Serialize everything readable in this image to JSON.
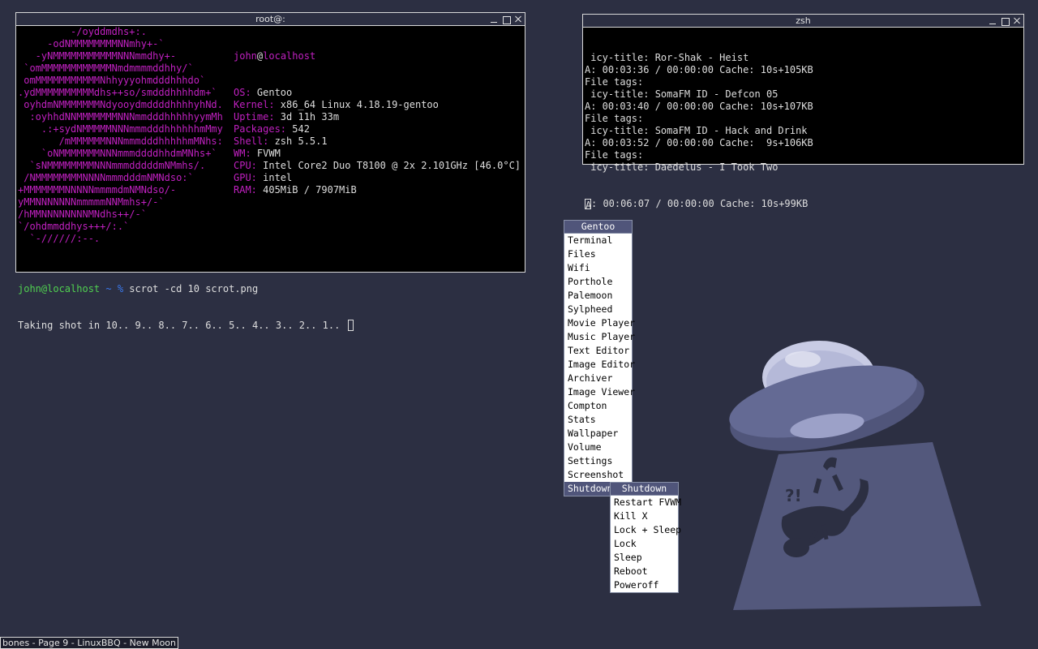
{
  "terminal1": {
    "title": "root@:",
    "logo": [
      "         -/oyddmdhs+:.",
      "     -odNMMMMMMMMNNmhy+-`",
      "   -yNMMMMMMMMMMMNNNmmdhy+-",
      " `omMMMMMMMMMMMMNmdmmmmddhhy/`",
      " omMMMMMMMMMMMNhhyyyohmdddhhhdo`",
      ".ydMMMMMMMMMMdhs++so/smdddhhhhdm+`",
      " oyhdmNMMMMMMMNdyooydmddddhhhhyhNd.",
      "  :oyhhdNNMMMMMMMNNNmmdddhhhhhyymMh",
      "    .:+sydNMMMMMNNNmmmdddhhhhhhmMmy",
      "       /mMMMMMMNNNmmmdddhhhhhmMNhs:",
      "    `oNMMMMMMMNNNmmmddddhhdmMNhs+`",
      "  `sNMMMMMMMMNNNmmmdddddmNMmhs/.",
      " /NMMMMMMMMNNNNmmmdddmNMNdso:`",
      "+MMMMMMMNNNNNmmmmdmNMNdso/-",
      "yMMNNNNNNNmmmmmNNMmhs+/-`",
      "/hMMNNNNNNNNMNdhs++/-`",
      "`/ohdmmddhys+++/:.`",
      "  `-//////:--."
    ],
    "info": {
      "user": "john",
      "at": "@",
      "host": "localhost",
      "rows": [
        {
          "key": "OS:",
          "value": " Gentoo"
        },
        {
          "key": "Kernel:",
          "value": " x86_64 Linux 4.18.19-gentoo"
        },
        {
          "key": "Uptime:",
          "value": " 3d 11h 33m"
        },
        {
          "key": "Packages:",
          "value": " 542"
        },
        {
          "key": "Shell:",
          "value": " zsh 5.5.1"
        },
        {
          "key": "WM:",
          "value": " FVWM"
        },
        {
          "key": "CPU:",
          "value": " Intel Core2 Duo T8100 @ 2x 2.101GHz [46.0°C]"
        },
        {
          "key": "GPU:",
          "value": " intel"
        },
        {
          "key": "RAM:",
          "value": " 405MiB / 7907MiB"
        }
      ]
    },
    "prompt": {
      "userhost": "john@localhost",
      "path": " ~ %",
      "command": " scrot -cd 10 scrot.png",
      "output": "Taking shot in 10.. 9.. 8.. 7.. 6.. 5.. 4.. 3.. 2.. 1.. "
    }
  },
  "terminal2": {
    "title": "zsh",
    "lines": [
      " icy-title: Ror-Shak - Heist",
      "A: 00:03:36 / 00:00:00 Cache: 10s+105KB",
      "File tags:",
      " icy-title: SomaFM ID - Defcon 05",
      "A: 00:03:40 / 00:00:00 Cache: 10s+107KB",
      "File tags:",
      " icy-title: SomaFM ID - Hack and Drink",
      "A: 00:03:52 / 00:00:00 Cache:  9s+106KB",
      "File tags:",
      " icy-title: Daedelus - I Took Two"
    ],
    "last_line": ": 00:06:07 / 00:00:00 Cache: 10s+99KB",
    "last_line_cursor_char": "A"
  },
  "menu": {
    "title": "Gentoo",
    "items": [
      "Terminal",
      "Files",
      "Wifi",
      "Porthole",
      "Palemoon",
      "Sylpheed",
      "Movie Player",
      "Music Player",
      "Text Editor",
      "Image Editor",
      "Archiver",
      "Image Viewer",
      "Compton",
      "Stats",
      "Wallpaper",
      "Volume",
      "Settings",
      "Screenshot",
      "Shutdown"
    ],
    "active_item": "Shutdown"
  },
  "submenu": {
    "title": "Shutdown",
    "items": [
      "Restart FVWM",
      "Kill X",
      "Lock + Sleep",
      "Lock",
      "Sleep",
      "Reboot",
      "Poweroff"
    ]
  },
  "statusbar": {
    "text": "bones - Page 9 - LinuxBBQ - New Moon"
  },
  "colors": {
    "desktop": "#2c2f42",
    "accent": "#c020c0",
    "prompt_green": "#50d050",
    "menu_highlight": "#50557a"
  }
}
